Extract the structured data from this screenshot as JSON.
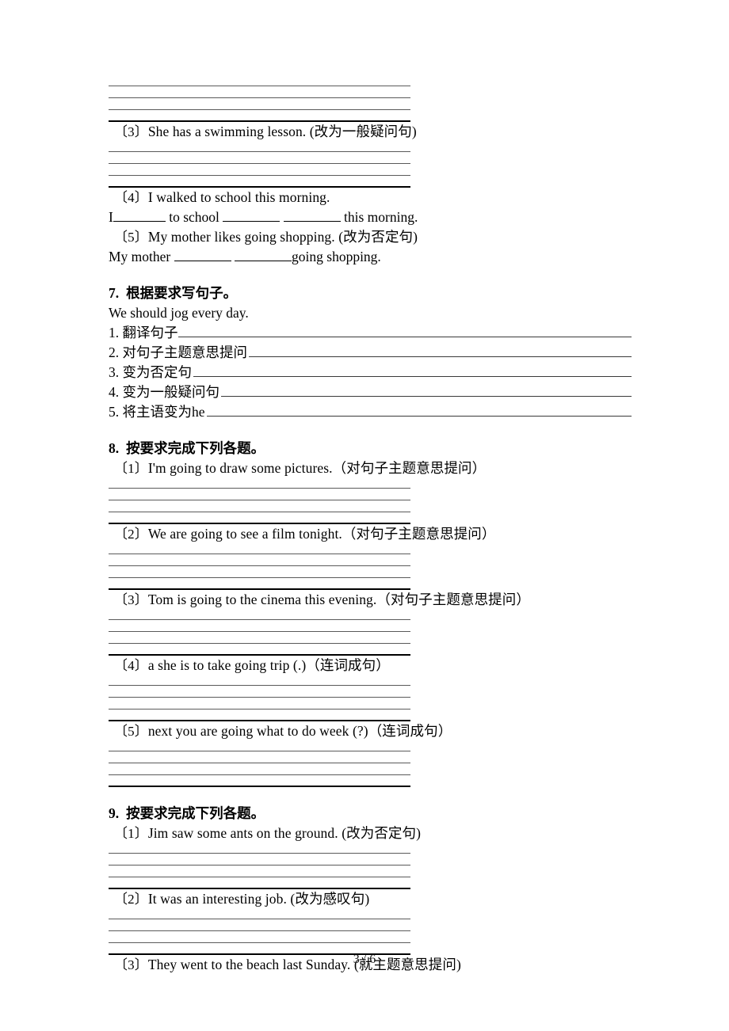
{
  "page": {
    "footer": "3 / 6",
    "number": "3",
    "total": "6"
  },
  "continued_section": {
    "items": [
      {
        "num": "〔3〕",
        "text": "She has a swimming lesson. (改为一般疑问句)",
        "answer_lines": 4
      },
      {
        "num": "〔4〕",
        "text": "I walked to school this morning.",
        "fill_line_pre": "I",
        "fill_line_mid1": "to school",
        "fill_line_post": "this morning."
      },
      {
        "num": "〔5〕",
        "text": "My mother likes going shopping. (改为否定句)",
        "fill_line_pre": "My mother",
        "fill_line_post": "going shopping."
      }
    ]
  },
  "section7": {
    "number": "7.",
    "title": "根据要求写句子。",
    "sentence": "We should jog every day.",
    "tasks": [
      {
        "label": "1. 翻译句子"
      },
      {
        "label": "2. 对句子主题意思提问"
      },
      {
        "label": "3. 变为否定句"
      },
      {
        "label": "4. 变为一般疑问句"
      },
      {
        "label": "5. 将主语变为he"
      }
    ]
  },
  "section8": {
    "number": "8.",
    "title": "按要求完成下列各题。",
    "items": [
      {
        "num": "〔1〕",
        "text": "I'm going to draw some pictures.（对句子主题意思提问）"
      },
      {
        "num": "〔2〕",
        "text": "We are going to see a film tonight.（对句子主题意思提问）"
      },
      {
        "num": "〔3〕",
        "text": "Tom is going to the cinema this evening.（对句子主题意思提问）"
      },
      {
        "num": "〔4〕",
        "text": "a she is to take going trip (.)（连词成句）"
      },
      {
        "num": "〔5〕",
        "text": "next you are going what to do week (?)（连词成句）"
      }
    ]
  },
  "section9": {
    "number": "9.",
    "title": "按要求完成下列各题。",
    "items": [
      {
        "num": "〔1〕",
        "text": "Jim saw some ants on the ground. (改为否定句)"
      },
      {
        "num": "〔2〕",
        "text": "It was an interesting job. (改为感叹句)"
      },
      {
        "num": "〔3〕",
        "text": "They went to the beach last Sunday. (就主题意思提问)"
      }
    ]
  }
}
